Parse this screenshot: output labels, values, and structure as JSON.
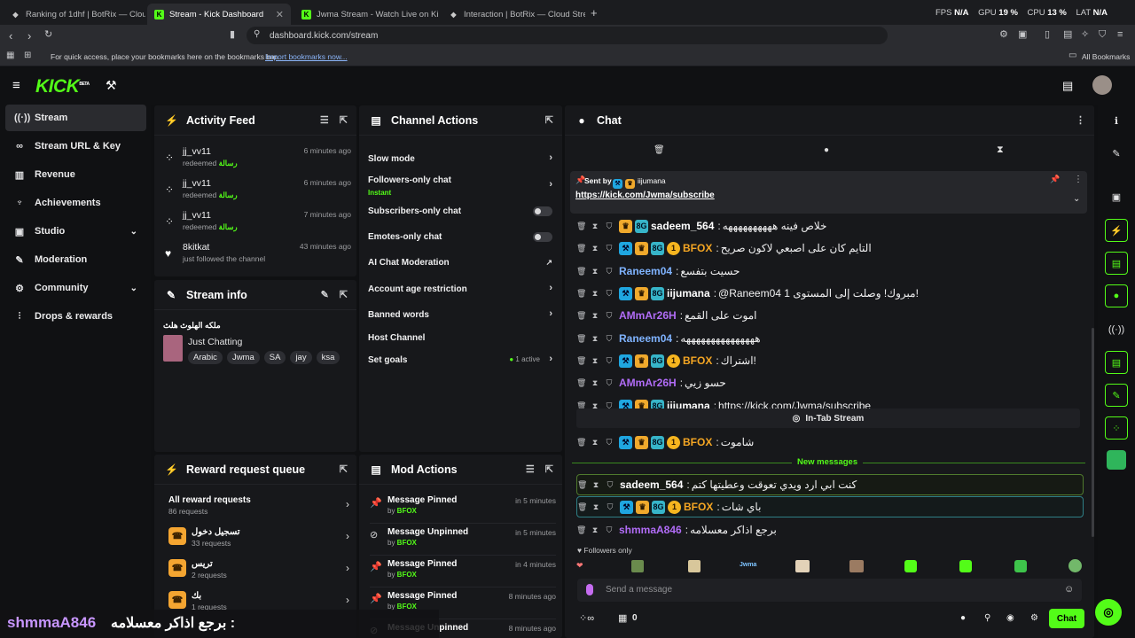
{
  "browser": {
    "tabs": [
      {
        "title": "Ranking of 1dhf | BotRix — Cloud Str"
      },
      {
        "title": "Stream - Kick Dashboard"
      },
      {
        "title": "Jwma Stream - Watch Live on Kick"
      },
      {
        "title": "Interaction | BotRix — Cloud Stream"
      }
    ],
    "stats": {
      "fps_label": "FPS",
      "fps": "N/A",
      "gpu_label": "GPU",
      "gpu": "19 %",
      "cpu_label": "CPU",
      "cpu": "13 %",
      "lat_label": "LAT",
      "lat": "N/A"
    },
    "url": "dashboard.kick.com/stream",
    "bookmarks_hint": "For quick access, place your bookmarks here on the bookmarks bar.",
    "import_link": "Import bookmarks now...",
    "all_bookmarks": "All Bookmarks"
  },
  "app": {
    "logo": "KICK",
    "logo_sup": "BETA"
  },
  "sidebar": {
    "items": [
      {
        "label": "Stream",
        "icon": "stream-icon"
      },
      {
        "label": "Stream URL & Key",
        "icon": "link-icon"
      },
      {
        "label": "Revenue",
        "icon": "revenue-icon"
      },
      {
        "label": "Achievements",
        "icon": "trophy-icon"
      },
      {
        "label": "Studio",
        "icon": "studio-icon"
      },
      {
        "label": "Moderation",
        "icon": "wrench-icon"
      },
      {
        "label": "Community",
        "icon": "community-icon"
      },
      {
        "label": "Drops & rewards",
        "icon": "drops-icon"
      }
    ]
  },
  "activity": {
    "title": "Activity Feed",
    "items": [
      {
        "user": "jj_vv11",
        "action": "redeemed",
        "reward": "رسالة",
        "time": "6 minutes ago"
      },
      {
        "user": "jj_vv11",
        "action": "redeemed",
        "reward": "رسالة",
        "time": "6 minutes ago"
      },
      {
        "user": "jj_vv11",
        "action": "redeemed",
        "reward": "رسالة",
        "time": "7 minutes ago"
      },
      {
        "user": "8kitkat",
        "action": "just followed the channel",
        "reward": "",
        "time": "43 minutes ago"
      }
    ]
  },
  "stream_info": {
    "title": "Stream info",
    "stream_title": "ملكه الهلوث هلث",
    "category": "Just Chatting",
    "tags": [
      "Arabic",
      "Jwma",
      "SA",
      "jay",
      "ksa"
    ]
  },
  "channel_actions": {
    "title": "Channel Actions",
    "items": [
      {
        "label": "Slow mode",
        "sub": "",
        "control": "arrow"
      },
      {
        "label": "Followers-only chat",
        "sub": "Instant",
        "control": "arrow"
      },
      {
        "label": "Subscribers-only chat",
        "sub": "",
        "control": "toggle"
      },
      {
        "label": "Emotes-only chat",
        "sub": "",
        "control": "toggle"
      },
      {
        "label": "AI Chat Moderation",
        "sub": "",
        "control": "external"
      },
      {
        "label": "Account age restriction",
        "sub": "",
        "control": "arrow"
      },
      {
        "label": "Banned words",
        "sub": "",
        "control": "arrow"
      },
      {
        "label": "Host Channel",
        "sub": "",
        "control": "none"
      },
      {
        "label": "Set goals",
        "sub": "",
        "control": "arrow",
        "status": "1 active"
      }
    ]
  },
  "reward_queue": {
    "title": "Reward request queue",
    "all_label": "All reward requests",
    "all_count": "86 requests",
    "items": [
      {
        "name": "تسجيل دخول",
        "count": "33 requests"
      },
      {
        "name": "تريس",
        "count": "2 requests"
      },
      {
        "name": "بك",
        "count": "1 requests"
      }
    ]
  },
  "mod_actions": {
    "title": "Mod Actions",
    "items": [
      {
        "action": "Message Pinned",
        "by": "BFOX",
        "time": "in 5 minutes",
        "icon": "pin-icon"
      },
      {
        "action": "Message Unpinned",
        "by": "BFOX",
        "time": "in 5 minutes",
        "icon": "unpin-icon"
      },
      {
        "action": "Message Pinned",
        "by": "BFOX",
        "time": "in 4 minutes",
        "icon": "pin-icon"
      },
      {
        "action": "Message Pinned",
        "by": "BFOX",
        "time": "8 minutes ago",
        "icon": "pin-icon"
      },
      {
        "action": "Message Unpinned",
        "by": "",
        "time": "8 minutes ago",
        "icon": "unpin-icon"
      }
    ]
  },
  "chat": {
    "title": "Chat",
    "pinned": {
      "sent_by": "Sent by",
      "user": "iijumana",
      "link": "https://kick.com/Jwma/subscribe"
    },
    "messages": [
      {
        "user": "sadeem_564",
        "color": "#ffffff",
        "text": "خلاص فينه ههههههههههه",
        "badges": [
          "b2",
          "b3"
        ]
      },
      {
        "user": "BFOX",
        "color": "#f5a623",
        "text": "التايم كان على اصبعي لاكون صريح",
        "badges": [
          "b1",
          "b2",
          "b3",
          "b4"
        ],
        "badge4": "1"
      },
      {
        "user": "Raneem04",
        "color": "#7fb3ff",
        "text": "حسيت بتفسع",
        "badges": []
      },
      {
        "user": "iijumana",
        "color": "#ffffff",
        "text": "@Raneem04 مبروك! وصلت إلى المستوى 1!",
        "badges": [
          "b1",
          "b2",
          "b3"
        ]
      },
      {
        "user": "AMmAr26H",
        "color": "#b16cf7",
        "text": "اموت على القمع",
        "badges": []
      },
      {
        "user": "Raneem04",
        "color": "#7fb3ff",
        "text": "هههههههههههههههه",
        "badges": []
      },
      {
        "user": "BFOX",
        "color": "#f5a623",
        "text": "اشتراك!",
        "badges": [
          "b1",
          "b2",
          "b3",
          "b4"
        ],
        "badge4": "1"
      },
      {
        "user": "AMmAr26H",
        "color": "#b16cf7",
        "text": "حسو زيي",
        "badges": []
      },
      {
        "user": "iijumana",
        "color": "#ffffff",
        "text": "https://kick.com/Jwma/subscribe",
        "badges": [
          "b1",
          "b2",
          "b3"
        ]
      }
    ],
    "system_label": "In-Tab Stream",
    "after_system": {
      "user": "BFOX",
      "color": "#f5a623",
      "text": "شاموت",
      "badge4": "1"
    },
    "new_messages_label": "New messages",
    "new_messages": [
      {
        "user": "sadeem_564",
        "color": "#ffffff",
        "text": "كنت ابي ارد ويدي تعوقت وعطيتها كتم"
      },
      {
        "user": "BFOX",
        "color": "#f5a623",
        "text": "باي شات",
        "badge4": "1"
      },
      {
        "user": "shmmaA846",
        "color": "#b16cf7",
        "text": "برجع اذاكر معسلامه"
      }
    ],
    "followers_only": "Followers only",
    "emotes": [
      "Jwma"
    ],
    "input_placeholder": "Send a message",
    "viewers": "0",
    "chat_button": "Chat"
  },
  "overlay": {
    "user": "shmmaA846",
    "text": "برجع اذاكر معسلامه :"
  }
}
